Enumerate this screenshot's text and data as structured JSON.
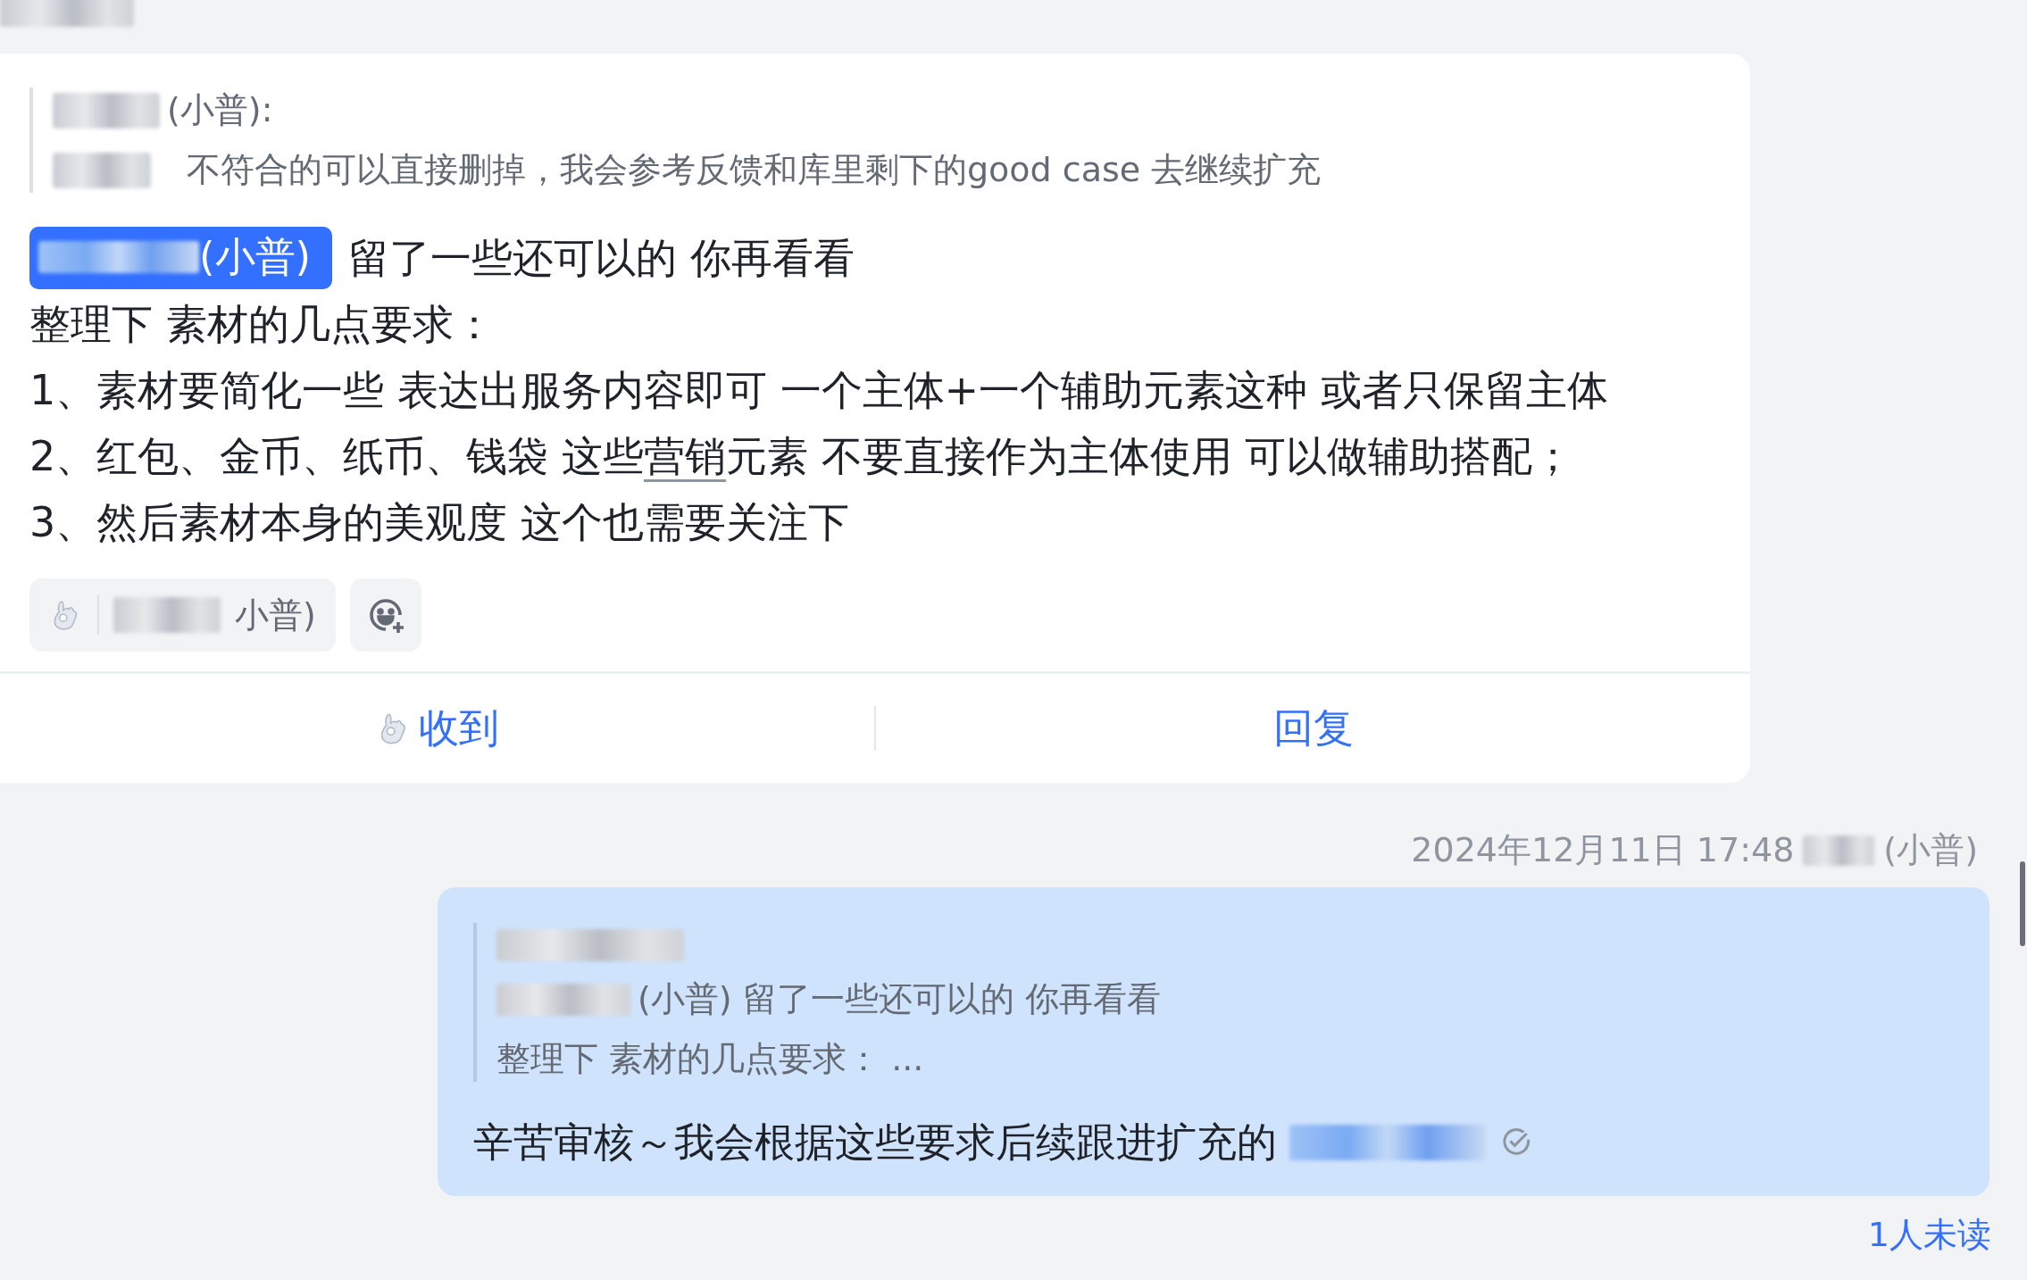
{
  "card": {
    "quote": {
      "author_suffix": "(小普):",
      "text": "不符合的可以直接删掉，我会参考反馈和库里剩下的good case 去继续扩充"
    },
    "mention": {
      "suffix": "(小普)"
    },
    "first_line": "留了一些还可以的 你再看看",
    "lines": [
      {
        "parts": [
          {
            "text": "整理下 素材的几点要求：",
            "underlined": false
          }
        ]
      },
      {
        "parts": [
          {
            "text": "1、素材要简化一些  表达出服务内容即可  一个主体+一个辅助元素这种 或者只保留主体",
            "underlined": false
          }
        ]
      },
      {
        "parts": [
          {
            "text": "2、红包、金币、纸币、钱袋 这些",
            "underlined": false
          },
          {
            "text": "营销",
            "underlined": true
          },
          {
            "text": "元素  不要直接作为主体使用  可以做辅助搭配；",
            "underlined": false
          }
        ]
      },
      {
        "parts": [
          {
            "text": "3、然后素材本身的美观度  这个也需要关注下",
            "underlined": false
          }
        ]
      }
    ],
    "reaction": {
      "reactor_suffix": "小普)"
    },
    "actions": [
      {
        "label": "收到",
        "kind": "ack"
      },
      {
        "label": "回复",
        "kind": "reply"
      }
    ]
  },
  "reply": {
    "timestamp": "2024年12月11日 17:48",
    "sender_suffix": "(小普)",
    "quote_lines": [
      "(小普)  留了一些还可以的 你再看看",
      "整理下 素材的几点要求： ..."
    ],
    "text": "辛苦审核～我会根据这些要求后续跟进扩充的",
    "read_status": "1人未读"
  }
}
